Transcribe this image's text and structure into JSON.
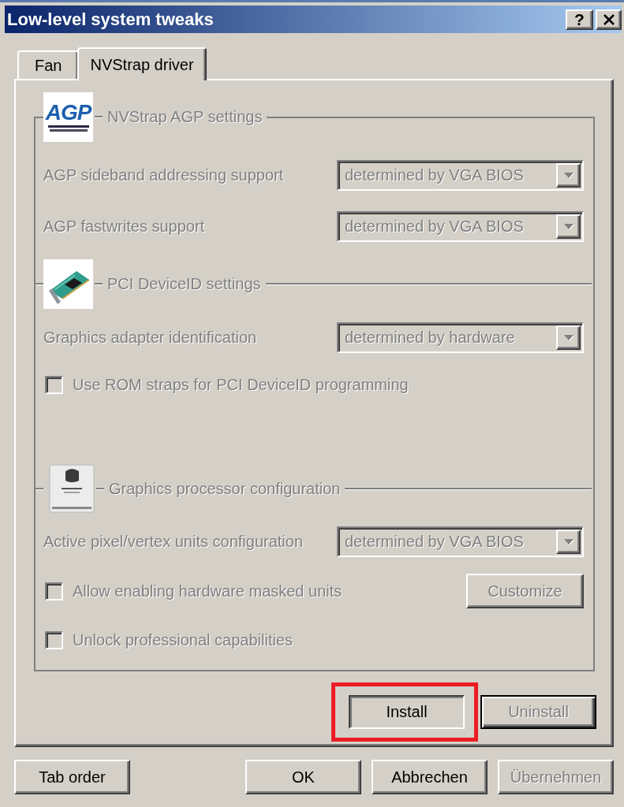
{
  "window": {
    "title": "Low-level system tweaks",
    "help_button": "?"
  },
  "tabs": [
    {
      "label": "Fan",
      "selected": false
    },
    {
      "label": "NVStrap driver",
      "selected": true
    }
  ],
  "sections": [
    {
      "kind": "group",
      "title": "NVStrap AGP settings",
      "logo_text": "AGP",
      "disabled": true,
      "rows": [
        {
          "kind": "dropdown",
          "label": "AGP sideband addressing support",
          "value": "determined by VGA BIOS",
          "disabled": true
        },
        {
          "kind": "dropdown",
          "label": "AGP fastwrites support",
          "value": "determined by VGA BIOS",
          "disabled": true
        }
      ]
    },
    {
      "kind": "divider",
      "title": "PCI DeviceID settings",
      "disabled": true,
      "rows": [
        {
          "kind": "dropdown",
          "label": "Graphics adapter identification",
          "value": "determined by hardware",
          "disabled": true
        },
        {
          "kind": "checkbox",
          "label": "Use ROM straps for PCI DeviceID programming",
          "checked": false,
          "disabled": true
        }
      ]
    },
    {
      "kind": "divider",
      "title": "Graphics processor configuration",
      "disabled": true,
      "rows": [
        {
          "kind": "dropdown",
          "label": "Active pixel/vertex units configuration",
          "value": "determined by VGA BIOS",
          "disabled": true
        },
        {
          "kind": "checkbox",
          "label": "Allow enabling hardware masked units",
          "checked": false,
          "disabled": true,
          "button": {
            "label": "Customize",
            "disabled": true
          }
        },
        {
          "kind": "checkbox",
          "label": "Unlock professional capabilities",
          "checked": false,
          "disabled": true
        }
      ]
    }
  ],
  "action_buttons": [
    {
      "label": "Install",
      "disabled": false,
      "pressed": true,
      "default": false,
      "highlighted": true
    },
    {
      "label": "Uninstall",
      "disabled": true,
      "pressed": false,
      "default": true,
      "highlighted": false
    }
  ],
  "footer_left": [
    {
      "label": "Tab order",
      "disabled": false
    }
  ],
  "footer_right": [
    {
      "label": "OK",
      "disabled": false
    },
    {
      "label": "Abbrechen",
      "disabled": false
    },
    {
      "label": "Übernehmen",
      "disabled": true
    }
  ]
}
